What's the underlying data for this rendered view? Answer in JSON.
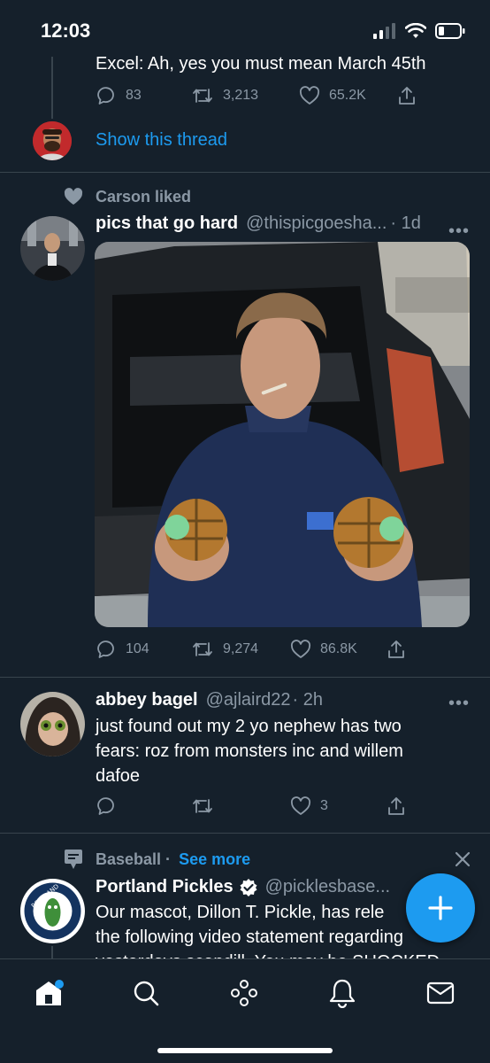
{
  "status": {
    "time": "12:03"
  },
  "thread_top": {
    "text": "Excel: Ah, yes you must mean March 45th",
    "replies": "83",
    "retweets": "3,213",
    "likes": "65.2K",
    "show_thread": "Show this thread"
  },
  "tweet1": {
    "social_context": "Carson liked",
    "name": "pics that go hard",
    "handle": "@thispicgoesha...",
    "time": "· 1d",
    "replies": "104",
    "retweets": "9,274",
    "likes": "86.8K"
  },
  "tweet2": {
    "name": "abbey bagel",
    "handle": "@ajlaird22",
    "time": "· 2h",
    "text": "just found out my 2 yo nephew has two fears: roz from monsters inc and willem dafoe",
    "likes": "3"
  },
  "tweet3": {
    "topic": "Baseball ·",
    "see_more": "See more",
    "name": "Portland Pickles",
    "handle": "@picklesbase...",
    "line1": "Our mascot, Dillon T. Pickle, has rele",
    "line2": "the following video statement regarding",
    "line3": "yesterdays scandill. You may be SHOCKED"
  },
  "colors": {
    "background": "#15202b",
    "accent": "#1d9bf0",
    "muted": "#8b98a5",
    "divider": "#38444d"
  }
}
